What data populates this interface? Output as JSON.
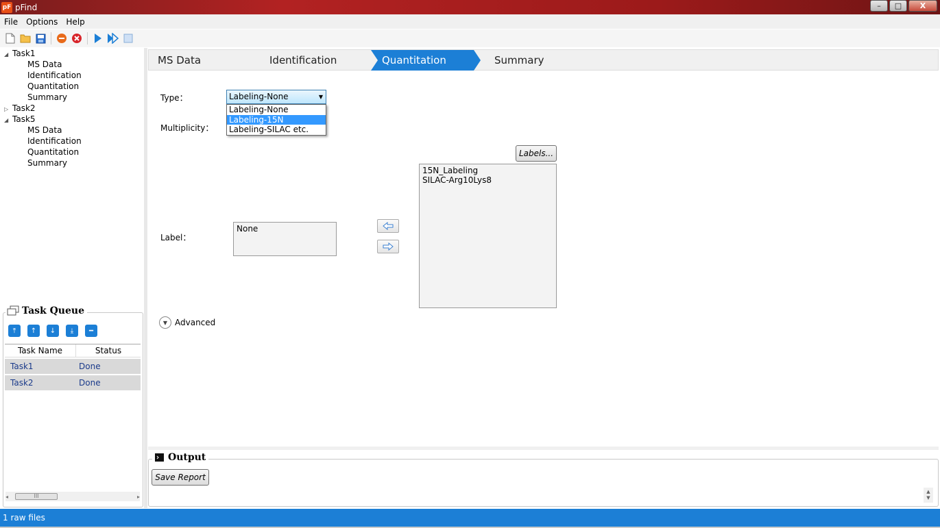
{
  "window": {
    "title": "pFind",
    "app_icon": "pF",
    "minimize": "–",
    "maximize": "□",
    "close": "X"
  },
  "menu": [
    "File",
    "Options",
    "Help"
  ],
  "toolbar": {
    "icons": [
      "new-file-icon",
      "open-folder-icon",
      "save-icon",
      "stop-icon",
      "delete-icon",
      "run-icon",
      "run-all-icon",
      "stop-square-icon"
    ]
  },
  "tree": [
    {
      "label": "Task1",
      "level": 0,
      "toggle": "◢"
    },
    {
      "label": "MS Data",
      "level": 1
    },
    {
      "label": "Identification",
      "level": 1
    },
    {
      "label": "Quantitation",
      "level": 1
    },
    {
      "label": "Summary",
      "level": 1
    },
    {
      "label": "Task2",
      "level": 0,
      "toggle": "▷"
    },
    {
      "label": "Task5",
      "level": 0,
      "toggle": "◢"
    },
    {
      "label": "MS Data",
      "level": 1
    },
    {
      "label": "Identification",
      "level": 1
    },
    {
      "label": "Quantitation",
      "level": 1
    },
    {
      "label": "Summary",
      "level": 1
    }
  ],
  "task_queue": {
    "title": "Task Queue",
    "columns": [
      "Task Name",
      "Status"
    ],
    "rows": [
      {
        "name": "Task1",
        "status": "Done"
      },
      {
        "name": "Task2",
        "status": "Done"
      }
    ],
    "scroll_thumb": "III"
  },
  "wizard_tabs": [
    "MS Data",
    "Identification",
    "Quantitation",
    "Summary"
  ],
  "active_tab": "Quantitation",
  "form": {
    "type_label": "Type：",
    "type_value": "Labeling-None",
    "type_options": [
      "Labeling-None",
      "Labeling-15N",
      "Labeling-SILAC etc."
    ],
    "type_highlighted": "Labeling-15N",
    "multiplicity_label": "Multiplicity：",
    "label_label": "Label：",
    "selected_labels": [
      "None"
    ],
    "available_labels": [
      "15N_Labeling",
      "SILAC-Arg10Lys8"
    ],
    "labels_button": "Labels...",
    "advanced": "Advanced"
  },
  "output": {
    "title": "Output",
    "save_report": "Save Report"
  },
  "status": {
    "text": "1 raw files"
  },
  "colors": {
    "accent": "#1c7fd6",
    "titlebar": "#b22222",
    "selection": "#3399ff"
  }
}
